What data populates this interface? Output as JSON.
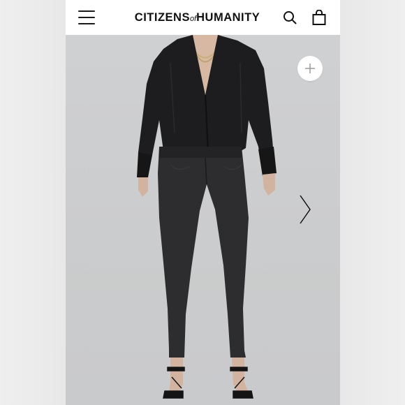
{
  "header": {
    "brand_left": "CITIZENS",
    "brand_of": "of",
    "brand_right": "HUMANITY",
    "menu_icon": "hamburger-menu-icon",
    "search_icon": "search-icon",
    "bag_icon": "shopping-bag-icon"
  },
  "gallery": {
    "zoom_icon": "plus-icon",
    "next_icon": "chevron-right-icon",
    "image_subject": "model-wearing-black-shirt-and-black-skinny-jeans"
  },
  "colors": {
    "header_bg": "#ffffff",
    "photo_bg": "#cccdce",
    "text": "#111111"
  }
}
